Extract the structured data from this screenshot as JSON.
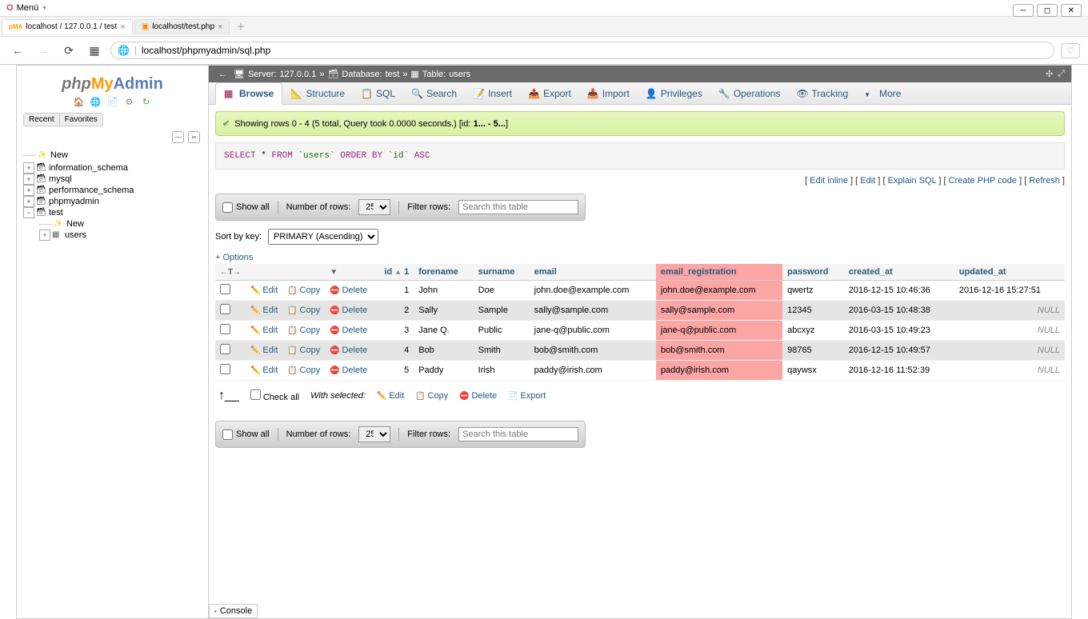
{
  "browser": {
    "menu_label": "Menü",
    "tabs": [
      {
        "title": "localhost / 127.0.0.1 / test",
        "favicon": "pma"
      },
      {
        "title": "localhost/test.php",
        "favicon": "xampp"
      }
    ],
    "url": "localhost/phpmyadmin/sql.php"
  },
  "sidebar": {
    "logo_php": "php",
    "logo_my": "My",
    "logo_admin": "Admin",
    "tabs": {
      "recent": "Recent",
      "favorites": "Favorites"
    },
    "nodes": {
      "new": "New",
      "dbs": [
        "information_schema",
        "mysql",
        "performance_schema",
        "phpmyadmin",
        "test"
      ],
      "test_children": {
        "new": "New",
        "tables": [
          "users"
        ]
      }
    }
  },
  "breadcrumb": {
    "server_label": "Server:",
    "server": "127.0.0.1",
    "db_label": "Database:",
    "db": "test",
    "table_label": "Table:",
    "table": "users"
  },
  "maintabs": [
    "Browse",
    "Structure",
    "SQL",
    "Search",
    "Insert",
    "Export",
    "Import",
    "Privileges",
    "Operations",
    "Tracking",
    "More"
  ],
  "message": {
    "text_prefix": "Showing rows 0 - 4 (5 total, Query took 0.0000 seconds.) [id: ",
    "text_strong": "1... - 5...",
    "text_suffix": "]"
  },
  "sql": {
    "select": "SELECT",
    "star": " * ",
    "from": "FROM",
    "table": " `users` ",
    "order": "ORDER",
    "by": "BY",
    "col": " `id` ",
    "asc": "ASC"
  },
  "sql_actions": [
    "Edit inline",
    "Edit",
    "Explain SQL",
    "Create PHP code",
    "Refresh"
  ],
  "controls": {
    "show_all": "Show all",
    "num_rows": "Number of rows:",
    "row_count": "25",
    "filter_label": "Filter rows:",
    "filter_placeholder": "Search this table"
  },
  "sortkey": {
    "label": "Sort by key:",
    "value": "PRIMARY (Ascending)"
  },
  "options_link": "+ Options",
  "columns": [
    "id",
    "forename",
    "surname",
    "email",
    "email_registration",
    "password",
    "created_at",
    "updated_at"
  ],
  "rows": [
    {
      "id": "1",
      "forename": "John",
      "surname": "Doe",
      "email": "john.doe@example.com",
      "email_registration": "john.doe@example.com",
      "password": "qwertz",
      "created_at": "2016-12-15 10:46:36",
      "updated_at": "2016-12-16 15:27:51"
    },
    {
      "id": "2",
      "forename": "Sally",
      "surname": "Sample",
      "email": "sally@sample.com",
      "email_registration": "sally@sample.com",
      "password": "12345",
      "created_at": "2016-03-15 10:48:38",
      "updated_at": null
    },
    {
      "id": "3",
      "forename": "Jane Q.",
      "surname": "Public",
      "email": "jane-q@public.com",
      "email_registration": "jane-q@public.com",
      "password": "abcxyz",
      "created_at": "2016-03-15 10:49:23",
      "updated_at": null
    },
    {
      "id": "4",
      "forename": "Bob",
      "surname": "Smith",
      "email": "bob@smith.com",
      "email_registration": "bob@smith.com",
      "password": "98765",
      "created_at": "2016-12-15 10:49:57",
      "updated_at": null
    },
    {
      "id": "5",
      "forename": "Paddy",
      "surname": "Irish",
      "email": "paddy@irish.com",
      "email_registration": "paddy@irish.com",
      "password": "qaywsx",
      "created_at": "2016-12-16 11:52:39",
      "updated_at": null
    }
  ],
  "row_actions": {
    "edit": "Edit",
    "copy": "Copy",
    "del": "Delete"
  },
  "footer": {
    "check_all": "Check all",
    "with_selected": "With selected:",
    "actions": {
      "edit": "Edit",
      "copy": "Copy",
      "del": "Delete",
      "export": "Export"
    }
  },
  "console_label": "Console",
  "null_text": "NULL",
  "th_one": "1"
}
